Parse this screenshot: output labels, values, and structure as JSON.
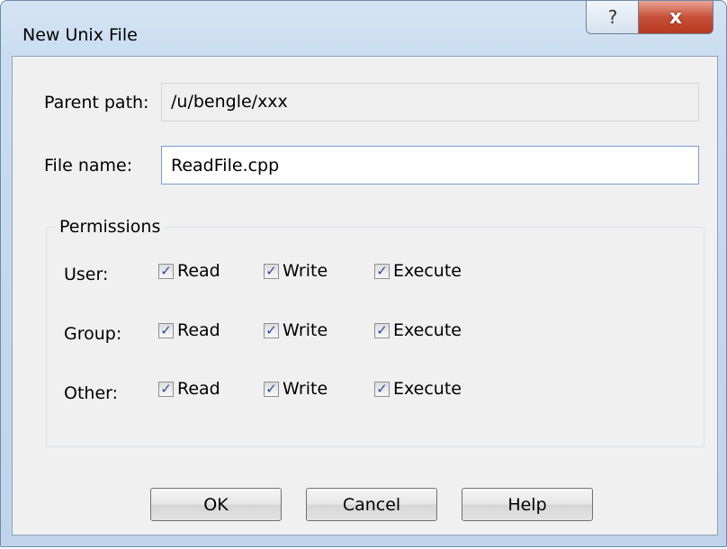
{
  "window": {
    "title": "New Unix File",
    "help_glyph": "?",
    "close_glyph": "x"
  },
  "form": {
    "parent_path_label": "Parent path:",
    "parent_path_value": "/u/bengle/xxx",
    "file_name_label": "File name:",
    "file_name_value": "ReadFile.cpp"
  },
  "permissions": {
    "title": "Permissions",
    "rows": [
      {
        "label": "User:",
        "read": "Read",
        "write": "Write",
        "execute": "Execute",
        "read_checked": true,
        "write_checked": true,
        "execute_checked": true
      },
      {
        "label": "Group:",
        "read": "Read",
        "write": "Write",
        "execute": "Execute",
        "read_checked": true,
        "write_checked": true,
        "execute_checked": true
      },
      {
        "label": "Other:",
        "read": "Read",
        "write": "Write",
        "execute": "Execute",
        "read_checked": true,
        "write_checked": true,
        "execute_checked": true
      }
    ],
    "check_glyph": "✓"
  },
  "buttons": {
    "ok": "OK",
    "cancel": "Cancel",
    "help": "Help"
  }
}
